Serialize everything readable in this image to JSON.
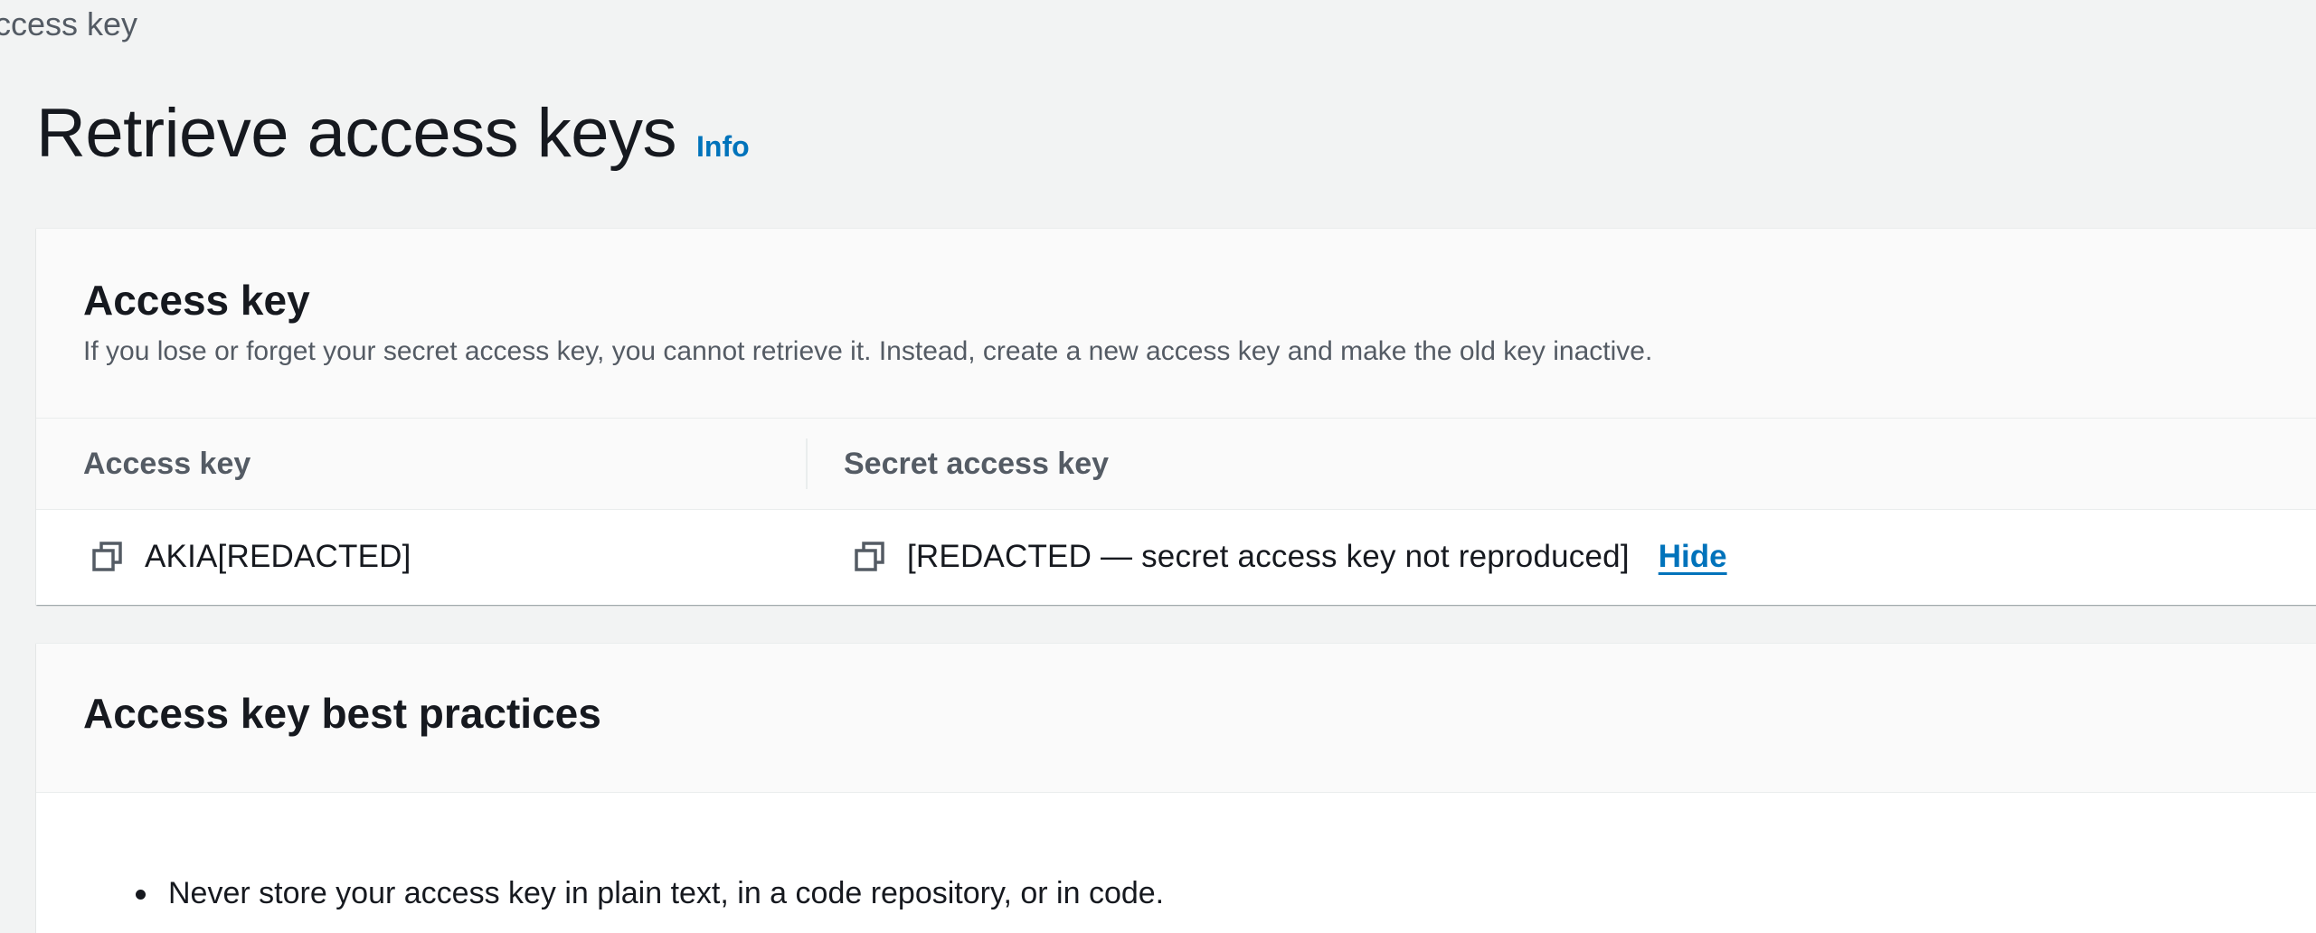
{
  "breadcrumb": {
    "current": "ccess key"
  },
  "header": {
    "title": "Retrieve access keys",
    "info_label": "Info"
  },
  "access_key_panel": {
    "title": "Access key",
    "description": "If you lose or forget your secret access key, you cannot retrieve it. Instead, create a new access key and make the old key inactive.",
    "columns": {
      "access_key": "Access key",
      "secret_access_key": "Secret access key"
    },
    "access_key_value": "AKIA[REDACTED]",
    "secret_access_key_value": "[REDACTED — secret access key not reproduced]",
    "hide_label": "Hide"
  },
  "best_practices_panel": {
    "title": "Access key best practices",
    "items": [
      "Never store your access key in plain text, in a code repository, or in code."
    ]
  },
  "colors": {
    "link": "#0073bb",
    "text": "#16191f",
    "secondary_text": "#545b64",
    "page_background": "#f2f3f3"
  },
  "icons": {
    "copy": "copy-icon"
  }
}
